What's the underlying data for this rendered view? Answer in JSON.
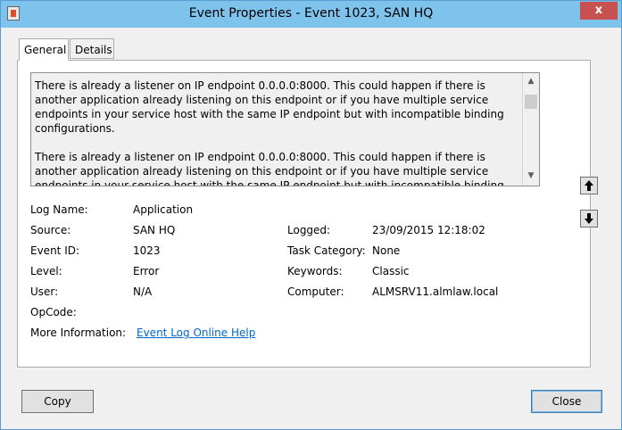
{
  "window": {
    "title": "Event Properties - Event 1023, SAN HQ",
    "close_label": "x"
  },
  "tabs": [
    {
      "label": "General",
      "active": true
    },
    {
      "label": "Details",
      "active": false
    }
  ],
  "description": "There is already a listener on IP endpoint 0.0.0.0:8000. This could happen if there is another application already listening on this endpoint or if you have multiple service endpoints in your service host with the same IP endpoint but with incompatible binding configurations.\n\nThere is already a listener on IP endpoint 0.0.0.0:8000. This could happen if there is another application already listening on this endpoint or if you have multiple service endpoints in your service host with the same IP endpoint but with incompatible binding configurations.\n",
  "fields": {
    "log_name": {
      "label": "Log Name:",
      "value": "Application"
    },
    "source": {
      "label": "Source:",
      "value": "SAN HQ"
    },
    "logged": {
      "label": "Logged:",
      "value": "23/09/2015 12:18:02"
    },
    "event_id": {
      "label": "Event ID:",
      "value": "1023"
    },
    "task_category": {
      "label": "Task Category:",
      "value": "None"
    },
    "level": {
      "label": "Level:",
      "value": "Error"
    },
    "keywords": {
      "label": "Keywords:",
      "value": "Classic"
    },
    "user": {
      "label": "User:",
      "value": "N/A"
    },
    "computer": {
      "label": "Computer:",
      "value": "ALMSRV11.almlaw.local"
    },
    "opcode": {
      "label": "OpCode:",
      "value": ""
    },
    "more_info": {
      "label": "More Information:",
      "value": "Event Log Online Help"
    }
  },
  "buttons": {
    "copy": "Copy",
    "close": "Close"
  }
}
